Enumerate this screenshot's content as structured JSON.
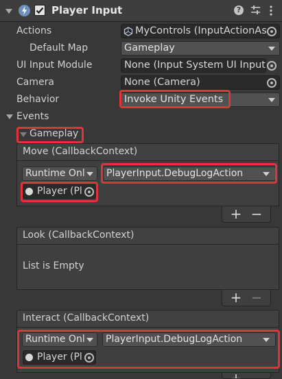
{
  "header": {
    "title": "Player Input",
    "icons": [
      "lightning-icon",
      "help-icon",
      "presets-icon",
      "kebab-menu-icon"
    ]
  },
  "props": {
    "actions_label": "Actions",
    "actions_value": "MyControls (InputActionAs",
    "default_map_label": "Default Map",
    "default_map_value": "Gameplay",
    "ui_input_label": "UI Input Module",
    "ui_input_value": "None (Input System UI Input I",
    "camera_label": "Camera",
    "camera_value": "None (Camera)",
    "behavior_label": "Behavior",
    "behavior_value": "Invoke Unity Events"
  },
  "events": {
    "label": "Events",
    "group_label": "Gameplay",
    "move": {
      "title": "Move (CallbackContext)",
      "runtime": "Runtime Onl",
      "function": "PlayerInput.DebugLogAction",
      "object": "Player (Pl"
    },
    "look": {
      "title": "Look (CallbackContext)",
      "empty": "List is Empty"
    },
    "interact": {
      "title": "Interact (CallbackContext)",
      "runtime": "Runtime Onl",
      "function": "PlayerInput.DebugLogAction",
      "object": "Player (Pl"
    },
    "plus": "+",
    "minus": "−"
  },
  "colors": {
    "highlight": "#e0343c",
    "background": "#383838",
    "field": "#2a2a2a"
  }
}
